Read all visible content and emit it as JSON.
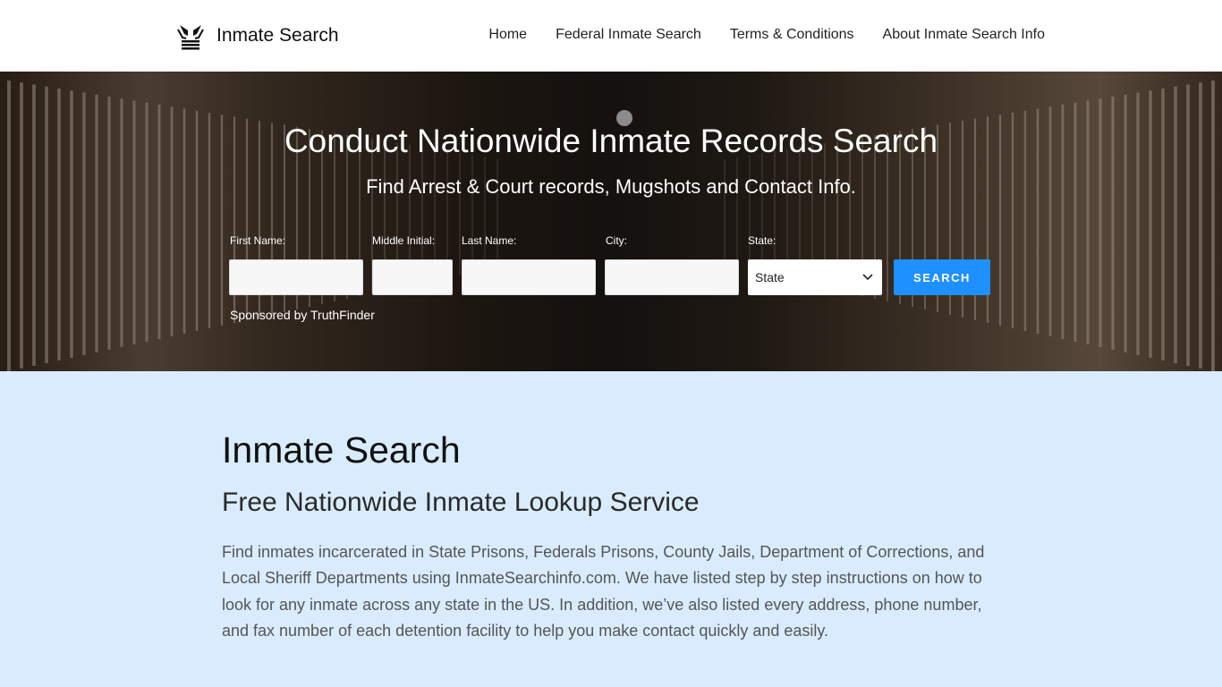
{
  "header": {
    "site_name": "Inmate Search",
    "nav": [
      {
        "label": "Home"
      },
      {
        "label": "Federal Inmate Search"
      },
      {
        "label": "Terms & Conditions"
      },
      {
        "label": "About Inmate Search Info"
      }
    ]
  },
  "hero": {
    "title": "Conduct Nationwide Inmate Records Search",
    "subtitle": "Find Arrest & Court records, Mugshots and Contact Info.",
    "form": {
      "first_name_label": "First Name:",
      "middle_initial_label": "Middle Initial:",
      "last_name_label": "Last Name:",
      "city_label": "City:",
      "state_label": "State:",
      "state_value": "State",
      "search_label": "SEARCH"
    },
    "sponsored": "Sponsored by TruthFinder"
  },
  "main": {
    "title": "Inmate Search",
    "subtitle": "Free Nationwide Inmate Lookup Service",
    "body": "Find inmates incarcerated in State Prisons, Federals Prisons, County Jails, Department of Corrections, and Local Sheriff Departments using InmateSearchinfo.com. We have listed step by step instructions on how to look for any inmate across any state in the US. In addition, we’ve also listed every address, phone number, and fax number of each detention facility to help you make contact quickly and easily."
  },
  "colors": {
    "accent": "#1e90ff",
    "content_bg": "#d9ecfd",
    "header_bg": "#ffffff"
  },
  "icons": {
    "logo": "hands-with-bars-icon",
    "select": "chevron-down-icon"
  }
}
